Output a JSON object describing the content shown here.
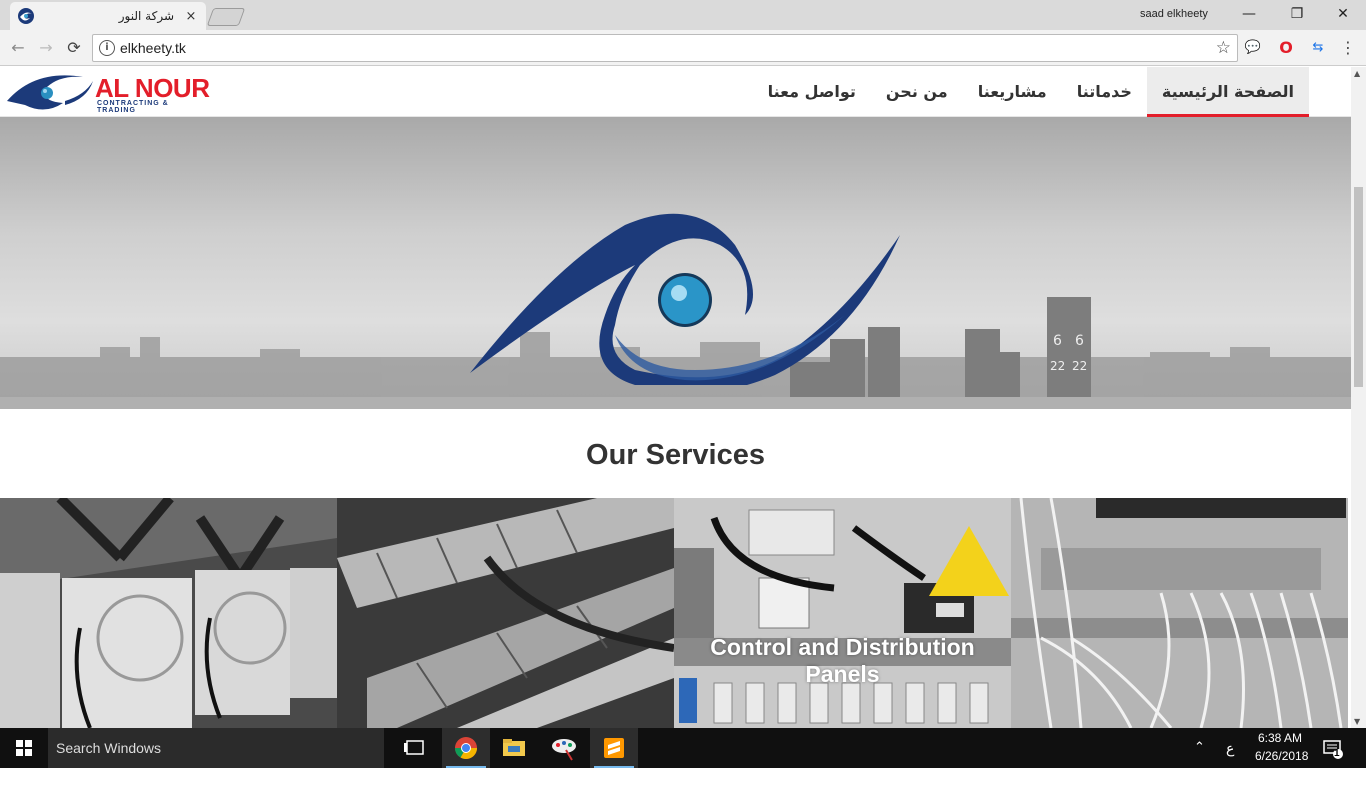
{
  "browser": {
    "tab_title": "شركة النور",
    "tab_close": "×",
    "user_name": "saad elkheety",
    "url": "elkheety.tk",
    "window_controls": {
      "minimize": "—",
      "maximize": "❐",
      "close": "✕"
    }
  },
  "site": {
    "logo": {
      "name": "AL NOUR",
      "tagline": "CONTRACTING & TRADING"
    },
    "menu": [
      {
        "label": "الصفحة الرئيسية",
        "active": true
      },
      {
        "label": "خدماتنا",
        "active": false
      },
      {
        "label": "مشاريعنا",
        "active": false
      },
      {
        "label": "من نحن",
        "active": false
      },
      {
        "label": "تواصل معنا",
        "active": false
      }
    ],
    "services_title": "Our Services",
    "cards": [
      {
        "label": "",
        "image": "air-conditioning-units"
      },
      {
        "label": "",
        "image": "cable-trays"
      },
      {
        "label": "Control and Distribution Panels",
        "image": "electrical-panel"
      },
      {
        "label": "",
        "image": "network-cabling"
      }
    ]
  },
  "taskbar": {
    "search_placeholder": "Search Windows",
    "lang": "ع",
    "time": "6:38 AM",
    "date": "6/26/2018",
    "notifications": "1"
  },
  "colors": {
    "brand_red": "#e31e2a",
    "brand_blue": "#1c3a7a"
  }
}
